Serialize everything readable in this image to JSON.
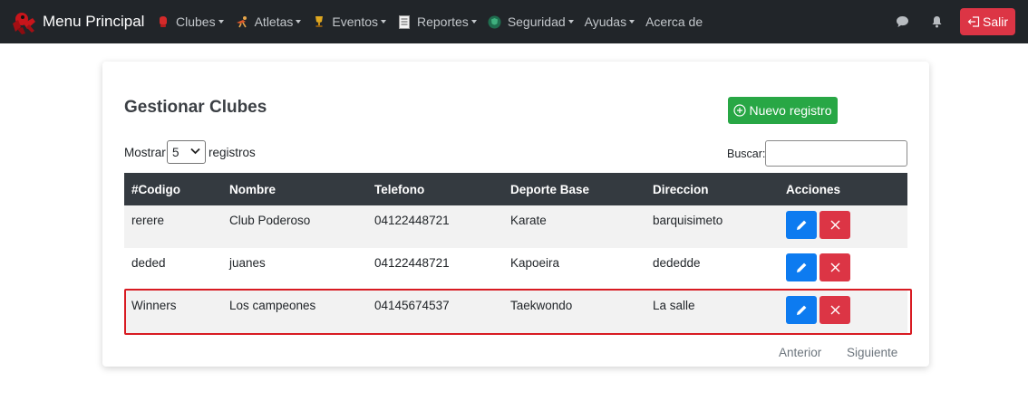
{
  "navbar": {
    "brand": "Menu Principal",
    "items": [
      {
        "label": "Clubes",
        "icon": "boxing-glove-icon"
      },
      {
        "label": "Atletas",
        "icon": "fighter-icon"
      },
      {
        "label": "Eventos",
        "icon": "trophy-icon"
      },
      {
        "label": "Reportes",
        "icon": "report-icon"
      },
      {
        "label": "Seguridad",
        "icon": "shield-icon"
      },
      {
        "label": "Ayudas",
        "icon": ""
      },
      {
        "label": "Acerca de",
        "icon": ""
      }
    ],
    "salir_label": "Salir"
  },
  "page": {
    "title": "Gestionar Clubes",
    "new_button": "Nuevo registro",
    "show_label": "Mostrar",
    "show_value": "5",
    "records_label": "registros",
    "search_label": "Buscar:",
    "search_value": ""
  },
  "table": {
    "headers": [
      "#Codigo",
      "Nombre",
      "Telefono",
      "Deporte Base",
      "Direccion",
      "Acciones"
    ],
    "rows": [
      [
        "rerere",
        "Club Poderoso",
        "04122448721",
        "Karate",
        "barquisimeto"
      ],
      [
        "deded",
        "juanes",
        "04122448721",
        "Kapoeira",
        "dededde"
      ],
      [
        "Winners",
        "Los campeones",
        "04145674537",
        "Taekwondo",
        "La salle"
      ]
    ]
  },
  "pagination": {
    "prev": "Anterior",
    "next": "Siguiente"
  },
  "colors": {
    "navbar": "#212529",
    "success": "#28a745",
    "danger": "#dc3545",
    "primary": "#0d7bf0",
    "highlight": "#d81b22"
  }
}
